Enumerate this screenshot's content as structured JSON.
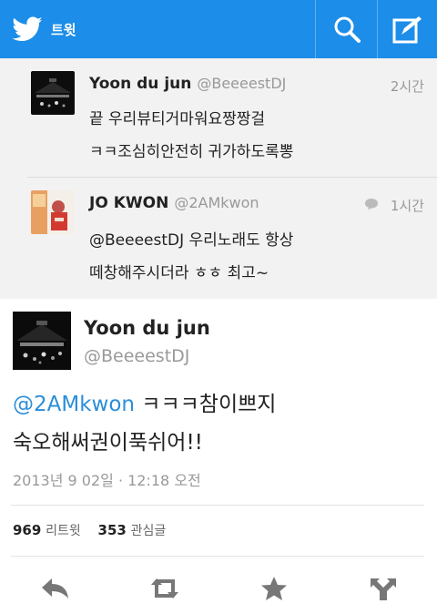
{
  "topbar": {
    "title": "트윗",
    "bar_color": "#1c8de8",
    "icons": [
      "twitter-bird-icon",
      "search-icon",
      "compose-icon"
    ]
  },
  "replies": [
    {
      "name": "Yoon du jun",
      "handle": "@BeeeestDJ",
      "time": "2시간",
      "lines": [
        "끝 우리뷰티거마워요짱짱걸",
        "ㅋㅋ조심히안전히 귀가하도록뽕"
      ]
    },
    {
      "name": "JO KWON",
      "handle": "@2AMkwon",
      "time": "1시간",
      "lines": [
        "@BeeeestDJ 우리노래도 항상",
        "떼창해주시더라 ㅎㅎ 최고~"
      ]
    }
  ],
  "main": {
    "name": "Yoon du jun",
    "handle": "@BeeeestDJ",
    "mention": "@2AMkwon",
    "text1_rest": " ㅋㅋㅋ참이쁘지",
    "text2": "숙오해써권이푹쉬어!!",
    "date": "2013년 9 02일 · 12:18 오전",
    "retweet_count": "969",
    "retweet_label": "리트윗",
    "favorite_count": "353",
    "favorite_label": "관심글",
    "mention_color": "#2b8ed9"
  },
  "actions": [
    "reply-icon",
    "retweet-icon",
    "favorite-icon",
    "more-share-icon"
  ]
}
